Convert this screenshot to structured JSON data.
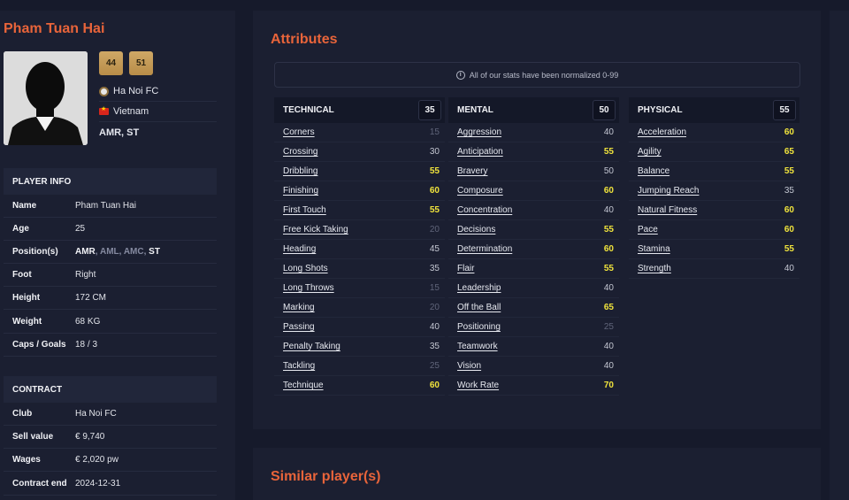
{
  "player": {
    "name": "Pham Tuan Hai",
    "ratings": [
      "44",
      "51"
    ],
    "club": "Ha Noi FC",
    "nation": "Vietnam",
    "positions_short": "AMR, ST"
  },
  "player_info": {
    "title": "PLAYER INFO",
    "name_label": "Name",
    "name_value": "Pham Tuan Hai",
    "age_label": "Age",
    "age_value": "25",
    "positions_label": "Position(s)",
    "positions": [
      {
        "text": "AMR",
        "natural": true
      },
      {
        "text": "AML",
        "natural": false
      },
      {
        "text": "AMC",
        "natural": false
      },
      {
        "text": "ST",
        "natural": true
      }
    ],
    "foot_label": "Foot",
    "foot_value": "Right",
    "height_label": "Height",
    "height_value": "172 CM",
    "weight_label": "Weight",
    "weight_value": "68 KG",
    "caps_label": "Caps / Goals",
    "caps_value": "18 / 3"
  },
  "contract": {
    "title": "CONTRACT",
    "club_label": "Club",
    "club_value": "Ha Noi FC",
    "sell_label": "Sell value",
    "sell_value": "€ 9,740",
    "wages_label": "Wages",
    "wages_value": "€ 2,020 pw",
    "end_label": "Contract end",
    "end_value": "2024-12-31"
  },
  "attributes": {
    "title": "Attributes",
    "notice": "All of our stats have been normalized 0-99",
    "columns": [
      {
        "name": "TECHNICAL",
        "score": "35",
        "items": [
          {
            "name": "Corners",
            "value": "15"
          },
          {
            "name": "Crossing",
            "value": "30"
          },
          {
            "name": "Dribbling",
            "value": "55"
          },
          {
            "name": "Finishing",
            "value": "60"
          },
          {
            "name": "First Touch",
            "value": "55"
          },
          {
            "name": "Free Kick Taking",
            "value": "20"
          },
          {
            "name": "Heading",
            "value": "45"
          },
          {
            "name": "Long Shots",
            "value": "35"
          },
          {
            "name": "Long Throws",
            "value": "15"
          },
          {
            "name": "Marking",
            "value": "20"
          },
          {
            "name": "Passing",
            "value": "40"
          },
          {
            "name": "Penalty Taking",
            "value": "35"
          },
          {
            "name": "Tackling",
            "value": "25"
          },
          {
            "name": "Technique",
            "value": "60"
          }
        ]
      },
      {
        "name": "MENTAL",
        "score": "50",
        "items": [
          {
            "name": "Aggression",
            "value": "40"
          },
          {
            "name": "Anticipation",
            "value": "55"
          },
          {
            "name": "Bravery",
            "value": "50"
          },
          {
            "name": "Composure",
            "value": "60"
          },
          {
            "name": "Concentration",
            "value": "40"
          },
          {
            "name": "Decisions",
            "value": "55"
          },
          {
            "name": "Determination",
            "value": "60"
          },
          {
            "name": "Flair",
            "value": "55"
          },
          {
            "name": "Leadership",
            "value": "40"
          },
          {
            "name": "Off the Ball",
            "value": "65"
          },
          {
            "name": "Positioning",
            "value": "25"
          },
          {
            "name": "Teamwork",
            "value": "40"
          },
          {
            "name": "Vision",
            "value": "40"
          },
          {
            "name": "Work Rate",
            "value": "70"
          }
        ]
      },
      {
        "name": "PHYSICAL",
        "score": "55",
        "items": [
          {
            "name": "Acceleration",
            "value": "60"
          },
          {
            "name": "Agility",
            "value": "65"
          },
          {
            "name": "Balance",
            "value": "55"
          },
          {
            "name": "Jumping Reach",
            "value": "35"
          },
          {
            "name": "Natural Fitness",
            "value": "60"
          },
          {
            "name": "Pace",
            "value": "60"
          },
          {
            "name": "Stamina",
            "value": "55"
          },
          {
            "name": "Strength",
            "value": "40"
          }
        ]
      }
    ]
  },
  "similar": {
    "title": "Similar player(s)"
  },
  "colors": {
    "accent": "#e8643a",
    "highlight": "#f0e33c",
    "low": "#5f6479",
    "background": "#161a2b",
    "panel": "#1b1f31"
  }
}
